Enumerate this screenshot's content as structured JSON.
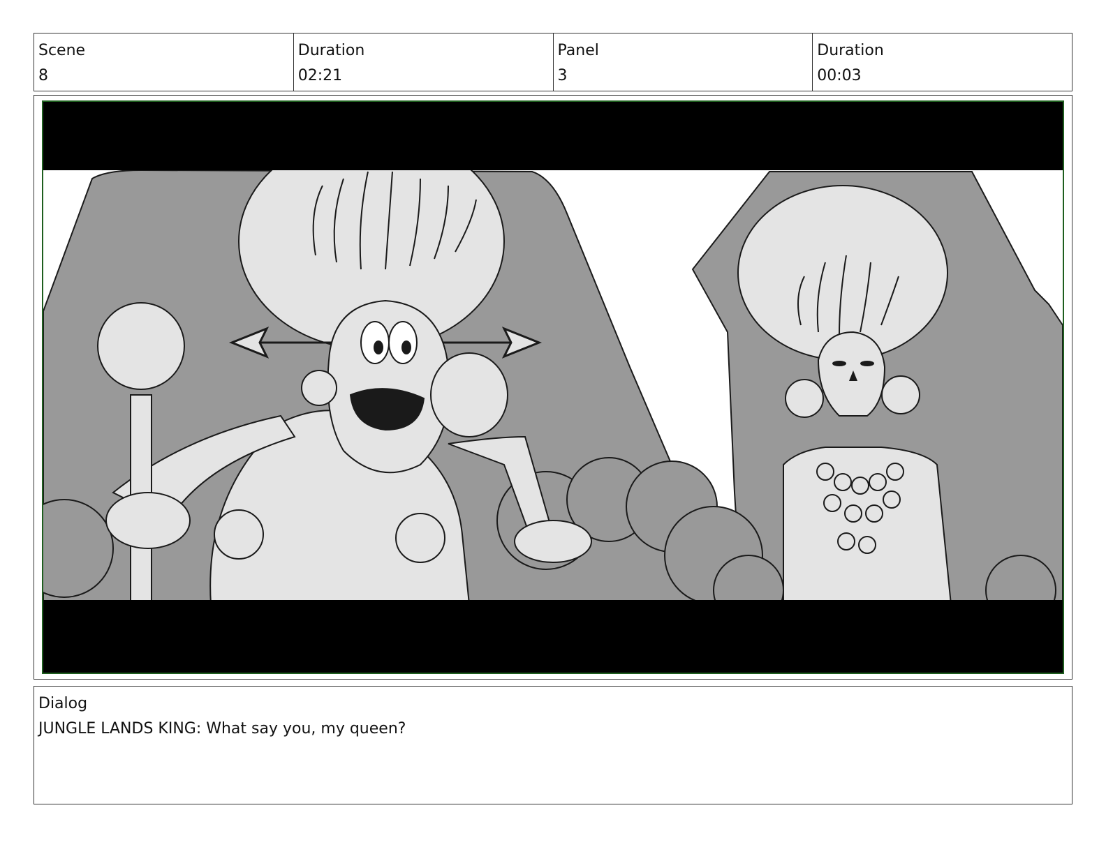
{
  "header": {
    "scene": {
      "label": "Scene",
      "value": "8"
    },
    "scene_duration": {
      "label": "Duration",
      "value": "02:21"
    },
    "panel": {
      "label": "Panel",
      "value": "3"
    },
    "panel_duration": {
      "label": "Duration",
      "value": "00:03"
    }
  },
  "dialog": {
    "label": "Dialog",
    "text": "JUNGLE LANDS KING: What say you, my queen?"
  },
  "colors": {
    "frame_border": "#1e5e1e",
    "letterbox": "#000000",
    "throne_gray": "#999999",
    "figure_light": "#e4e4e4"
  },
  "panel_image": {
    "description_icon": "storyboard-sketch"
  }
}
